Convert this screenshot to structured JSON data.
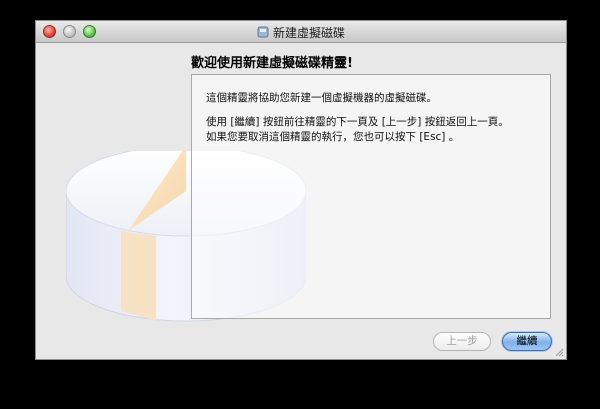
{
  "window": {
    "title": "新建虛擬磁碟"
  },
  "heading": "歡迎使用新建虛擬磁碟精靈!",
  "content": {
    "paragraph1": "這個精靈將協助您新建一個虛擬機器的虛擬磁碟。",
    "paragraph2_line1": "使用 [繼續] 按鈕前往精靈的下一頁及 [上一步] 按鈕返回上一頁。",
    "paragraph2_line2": "如果您要取消這個精靈的執行，您也可以按下 [Esc] 。"
  },
  "buttons": {
    "back_label": "上一步",
    "next_label": "繼續"
  },
  "icons": {
    "title": "disk-icon",
    "art": "virtual-disk-illustration"
  },
  "colors": {
    "accent": "#7eb0ea",
    "window_bg": "#e8e8e8",
    "close": "#e0443a",
    "zoom": "#5fc24c"
  }
}
